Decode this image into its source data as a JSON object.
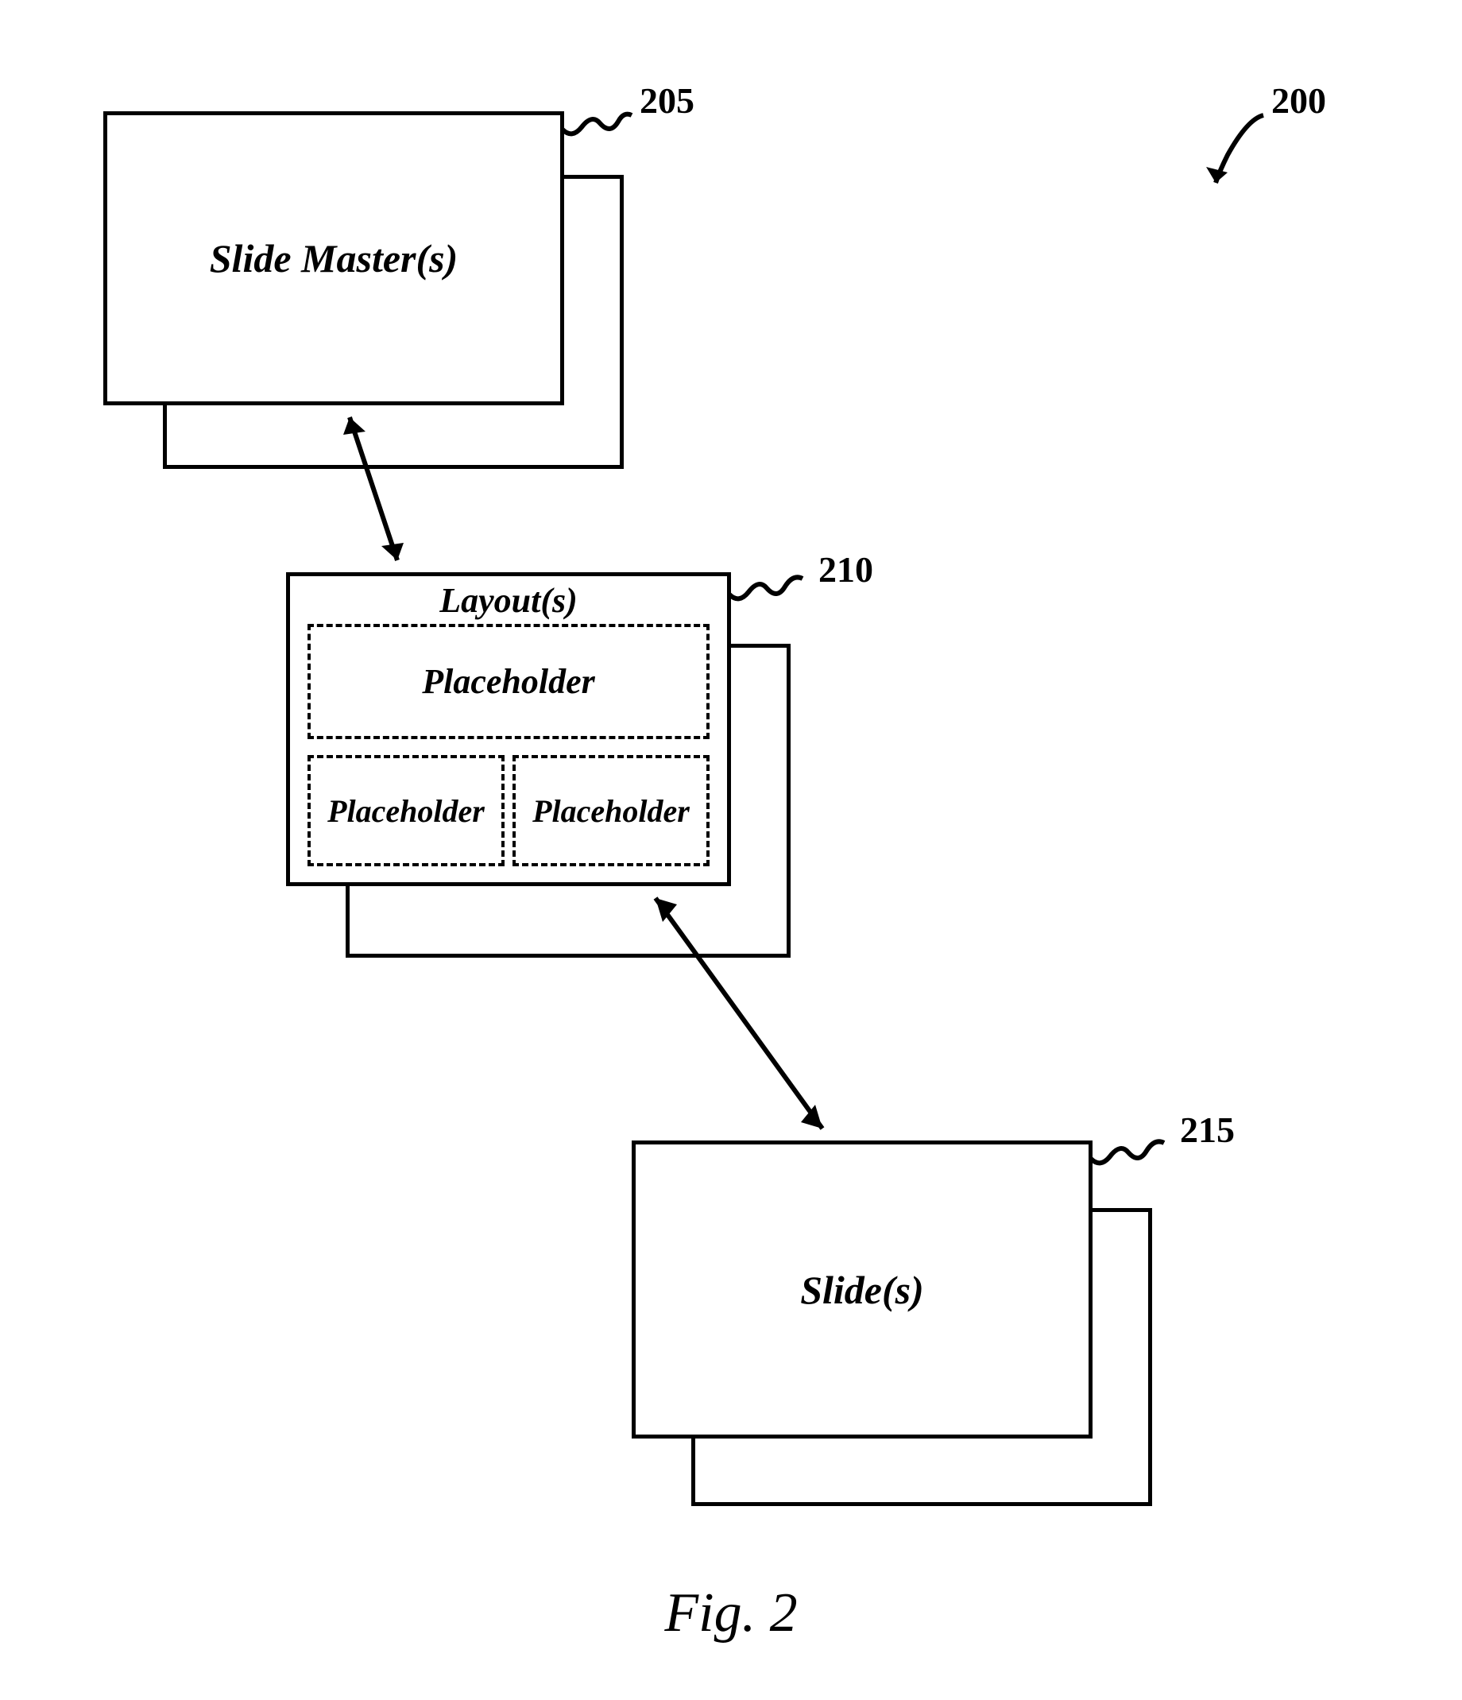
{
  "figure": {
    "caption": "Fig. 2",
    "main_ref": "200",
    "nodes": {
      "master": {
        "label": "Slide Master(s)",
        "ref": "205"
      },
      "layout": {
        "label": "Layout(s)",
        "ref": "210",
        "placeholders": {
          "top": "Placeholder",
          "bottom_left": "Placeholder",
          "bottom_right": "Placeholder"
        }
      },
      "slide": {
        "label": "Slide(s)",
        "ref": "215"
      }
    }
  }
}
